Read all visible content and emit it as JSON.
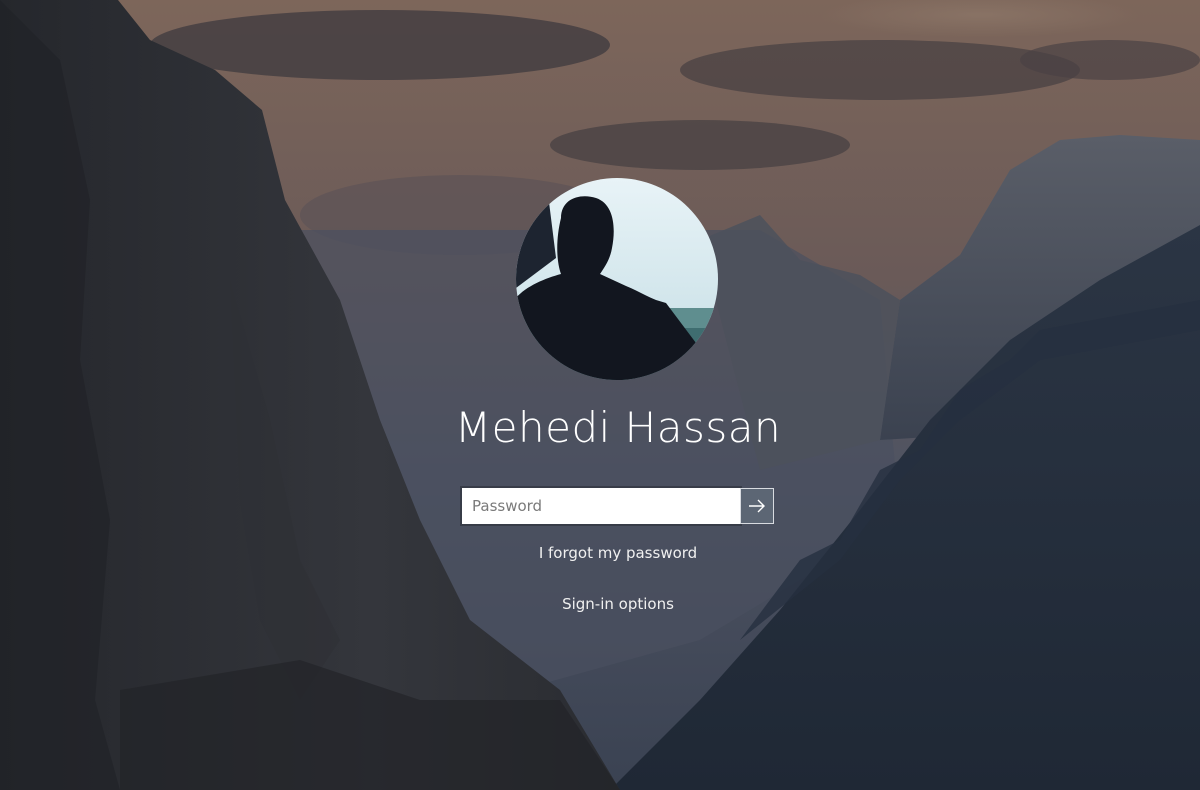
{
  "user": {
    "name": "Mehedi Hassan"
  },
  "password": {
    "placeholder": "Password",
    "value": "",
    "submit_icon": "arrow-right-icon"
  },
  "links": {
    "forgot_password": "I forgot my password",
    "sign_in_options": "Sign-in options"
  },
  "colors": {
    "sky": "#6e5a52",
    "mountains": "#2c3444",
    "submit_button": "#5c6674",
    "text": "#ffffff"
  }
}
